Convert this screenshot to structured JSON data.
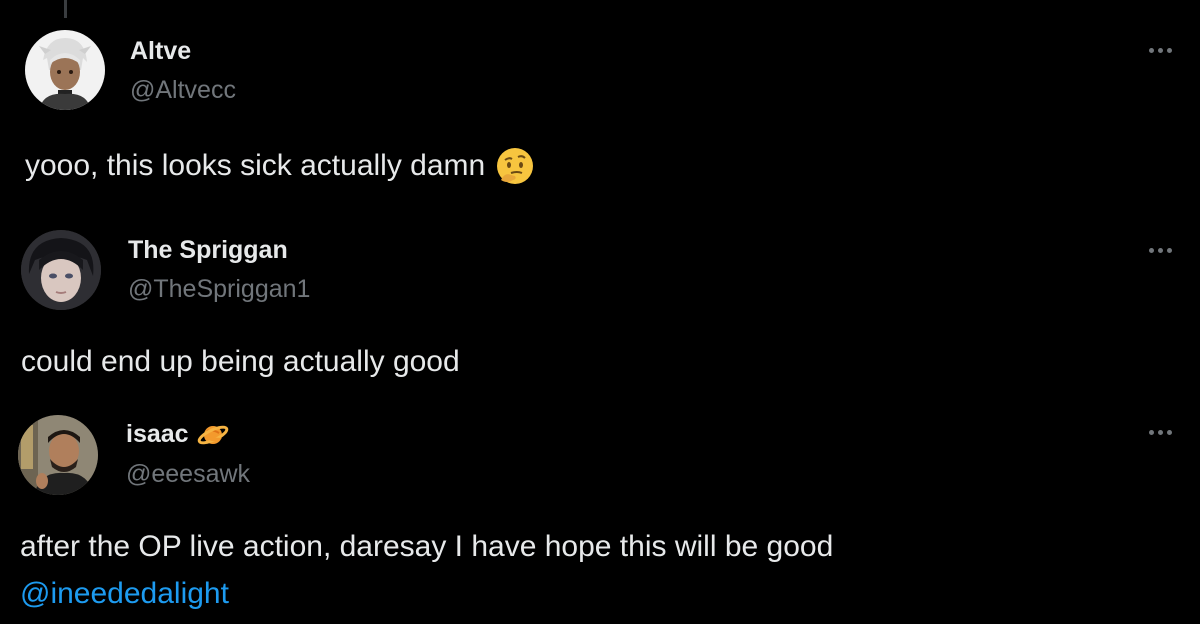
{
  "replies": [
    {
      "display_name": "Altve",
      "handle": "@Altvecc",
      "text": "yooo, this looks sick actually damn",
      "emoji": "thinking-face-icon"
    },
    {
      "display_name": "The Spriggan",
      "handle": "@TheSpriggan1",
      "text": "could end up being actually good"
    },
    {
      "display_name": "isaac",
      "name_badge": "ringed-planet-icon",
      "handle": "@eeesawk",
      "text": "after the OP live action, daresay I have hope this will be good",
      "mention": "@ineededalight"
    }
  ],
  "colors": {
    "background": "#000000",
    "primary_text": "#e7e9ea",
    "secondary_text": "#71767b",
    "link": "#1d9bf0"
  }
}
